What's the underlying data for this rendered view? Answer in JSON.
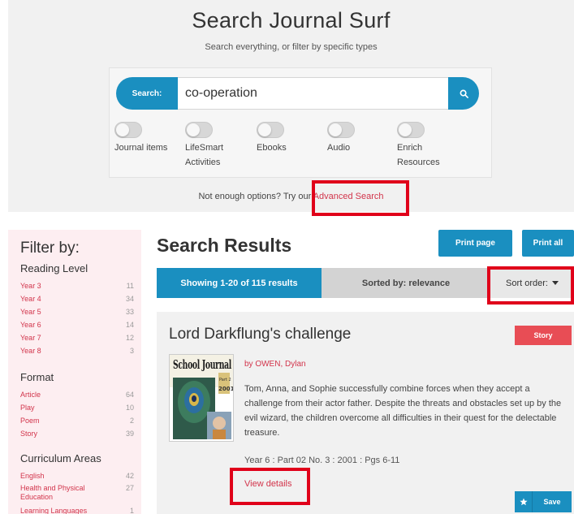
{
  "search": {
    "title": "Search Journal Surf",
    "subtitle": "Search everything, or filter by specific types",
    "label": "Search:",
    "query": "co-operation",
    "button_icon": "search-icon",
    "toggles": [
      {
        "label": "Journal items",
        "on": false
      },
      {
        "label": "LifeSmart Activities",
        "on": false
      },
      {
        "label": "Ebooks",
        "on": false
      },
      {
        "label": "Audio",
        "on": false
      },
      {
        "label": "Enrich Resources",
        "on": false
      }
    ],
    "options_text": "Not enough options? Try our",
    "advanced_link": "Advanced Search"
  },
  "filter": {
    "title": "Filter by:",
    "sections": [
      {
        "heading": "Reading Level",
        "items": [
          {
            "name": "Year 3",
            "count": "11"
          },
          {
            "name": "Year 4",
            "count": "34"
          },
          {
            "name": "Year 5",
            "count": "33"
          },
          {
            "name": "Year 6",
            "count": "14"
          },
          {
            "name": "Year 7",
            "count": "12"
          },
          {
            "name": "Year 8",
            "count": "3"
          }
        ]
      },
      {
        "heading": "Format",
        "items": [
          {
            "name": "Article",
            "count": "64"
          },
          {
            "name": "Play",
            "count": "10"
          },
          {
            "name": "Poem",
            "count": "2"
          },
          {
            "name": "Story",
            "count": "39"
          }
        ]
      },
      {
        "heading": "Curriculum Areas",
        "items": [
          {
            "name": "English",
            "count": "42"
          },
          {
            "name": "Health and Physical Education",
            "count": "27"
          },
          {
            "name": "Learning Languages",
            "count": "1"
          }
        ]
      }
    ]
  },
  "results": {
    "title": "Search Results",
    "print_page": "Print page",
    "print_all": "Print all",
    "showing": "Showing 1-20 of 115 results",
    "sorted_by": "Sorted by: relevance",
    "sort_order": "Sort order:"
  },
  "result": {
    "title": "Lord Darkflung's challenge",
    "badge": "Story",
    "cover_text": "School Journal",
    "cover_part": "Part 2",
    "cover_year": "2001",
    "author": "by OWEN, Dylan",
    "summary": "Tom, Anna, and Sophie successfully combine forces when they accept a challenge from their actor father. Despite the threats and obstacles set up by the evil wizard, the children overcome all difficulties in their quest for the delectable treasure.",
    "meta": "Year 6 : Part 02 No. 3 : 2001 : Pgs 6-11",
    "view_details": "View details",
    "save": "Save"
  },
  "colors": {
    "accent": "#1a8fc0",
    "link": "#d2344b",
    "badge": "#e84d55",
    "highlight_box": "#e0001a",
    "filter_bg": "#fdeef1"
  }
}
